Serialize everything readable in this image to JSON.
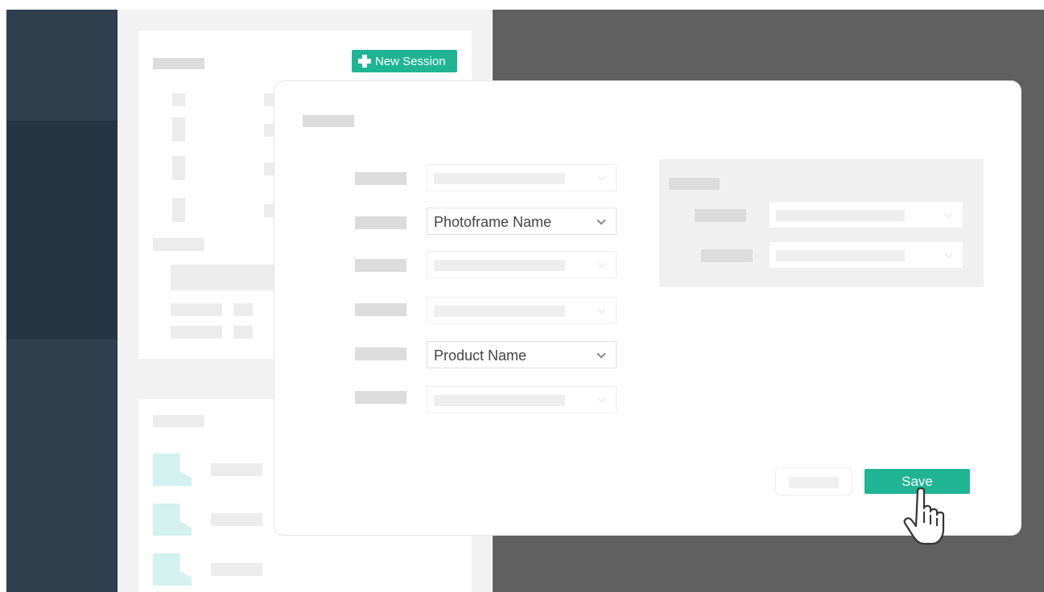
{
  "colors": {
    "sidebar": "#2f3f4e",
    "sidebar_active": "#263544",
    "accent": "#1fb594",
    "overlay": "#606060",
    "thumbnail": "#d3f1ef"
  },
  "header": {
    "new_session_label": "New Session",
    "new_session_icon": "plus-icon"
  },
  "modal": {
    "fields": [
      {
        "value": ""
      },
      {
        "value": "Photoframe Name"
      },
      {
        "value": ""
      },
      {
        "value": ""
      },
      {
        "value": "Product Name"
      },
      {
        "value": ""
      }
    ],
    "save_label": "Save",
    "cursor_icon": "hand-pointer-icon"
  }
}
